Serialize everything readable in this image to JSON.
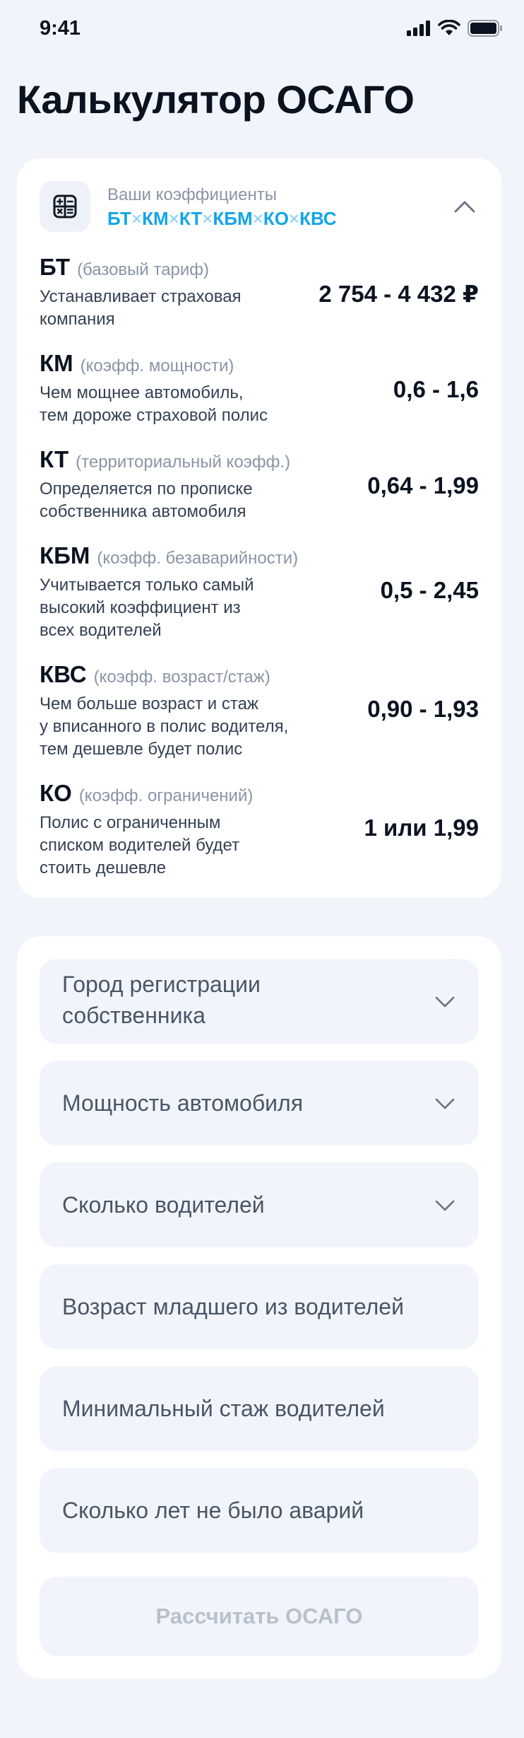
{
  "status_bar": {
    "time": "9:41",
    "icons": [
      "signal-icon",
      "wifi-icon",
      "battery-icon"
    ]
  },
  "page": {
    "title": "Калькулятор ОСАГО"
  },
  "coefficients": {
    "header_caption": "Ваши коэффициенты",
    "formula_parts": [
      "БТ",
      "КМ",
      "КТ",
      "КБМ",
      "КО",
      "КВС"
    ],
    "formula_separator": "×",
    "collapse_icon": "chevron-up-icon",
    "items": [
      {
        "code": "БТ",
        "note": "(базовый тариф)",
        "desc_lines": [
          "Устанавливает страховая",
          "компания"
        ],
        "value": "2 754 - 4 432 ₽"
      },
      {
        "code": "КМ",
        "note": "(коэфф. мощности)",
        "desc_lines": [
          "Чем мощнее автомобиль,",
          "тем дороже страховой полис"
        ],
        "value": "0,6 - 1,6"
      },
      {
        "code": "КТ",
        "note": "(территориальный коэфф.)",
        "desc_lines": [
          "Определяется по прописке",
          "собственника автомобиля"
        ],
        "value": "0,64 - 1,99"
      },
      {
        "code": "КБМ",
        "note": "(коэфф. безаварийности)",
        "desc_lines": [
          "Учитывается только самый",
          "высокий коэффициент из",
          "всех водителей"
        ],
        "value": "0,5 - 2,45"
      },
      {
        "code": "КВС",
        "note": "(коэфф. возраст/стаж)",
        "desc_lines": [
          "Чем больше возраст и стаж",
          "у вписанного в полис водителя,",
          "тем дешевле будет полис"
        ],
        "value": "0,90 - 1,93"
      },
      {
        "code": "КО",
        "note": "(коэфф. ограничений)",
        "desc_lines": [
          "Полис с ограниченным",
          "списком водителей будет",
          "стоить дешевле"
        ],
        "value": "1 или 1,99"
      }
    ]
  },
  "form": {
    "fields": [
      {
        "label_lines": [
          "Город регистрации",
          "собственника"
        ],
        "type": "select"
      },
      {
        "label_lines": [
          "Мощность автомобиля"
        ],
        "type": "select"
      },
      {
        "label_lines": [
          "Сколько водителей"
        ],
        "type": "select"
      },
      {
        "label_lines": [
          "Возраст младшего из водителей"
        ],
        "type": "input"
      },
      {
        "label_lines": [
          "Минимальный стаж водителей"
        ],
        "type": "input"
      },
      {
        "label_lines": [
          "Сколько лет не было аварий"
        ],
        "type": "input"
      }
    ],
    "submit_label": "Рассчитать ОСАГО",
    "submit_enabled": false
  },
  "colors": {
    "background": "#F1F5FB",
    "card": "#FFFFFF",
    "accent": "#12A5E8",
    "muted_text": "#8A94A6",
    "disabled_text": "#B8C0CC"
  }
}
